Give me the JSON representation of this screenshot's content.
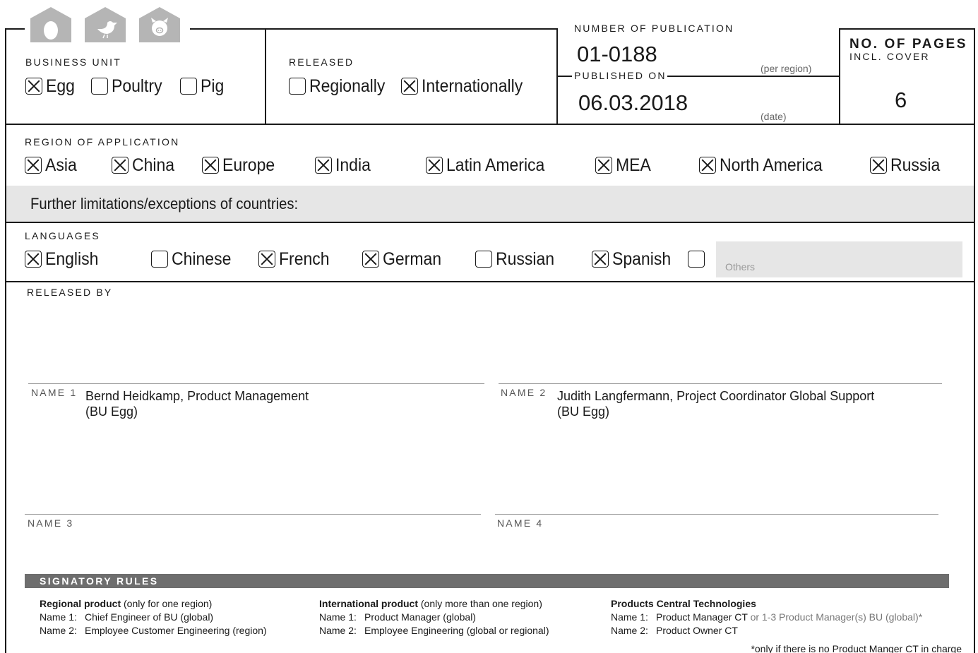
{
  "business_unit": {
    "label": "BUSINESS UNIT",
    "options": [
      {
        "label": "Egg",
        "checked": true
      },
      {
        "label": "Poultry",
        "checked": false
      },
      {
        "label": "Pig",
        "checked": false
      }
    ],
    "icons": [
      "egg-icon",
      "bird-icon",
      "pig-icon"
    ]
  },
  "released": {
    "label": "RELEASED",
    "options": [
      {
        "label": "Regionally",
        "checked": false
      },
      {
        "label": "Internationally",
        "checked": true
      }
    ]
  },
  "publication": {
    "number_label": "NUMBER OF PUBLICATION",
    "number": "01-0188",
    "number_hint": "(per region)",
    "published_label": "PUBLISHED ON",
    "date": "06.03.2018",
    "date_hint": "(date)"
  },
  "pages": {
    "label": "NO. OF PAGES",
    "sublabel": "INCL. COVER",
    "value": "6"
  },
  "region": {
    "label": "REGION OF APPLICATION",
    "options": [
      {
        "label": "Asia",
        "checked": true
      },
      {
        "label": "China",
        "checked": true
      },
      {
        "label": "Europe",
        "checked": true
      },
      {
        "label": "India",
        "checked": true
      },
      {
        "label": "Latin America",
        "checked": true
      },
      {
        "label": "MEA",
        "checked": true
      },
      {
        "label": "North America",
        "checked": true
      },
      {
        "label": "Russia",
        "checked": true
      }
    ],
    "limitations_label": "Further limitations/exceptions of countries:"
  },
  "languages": {
    "label": "LANGUAGES",
    "options": [
      {
        "label": "English",
        "checked": true
      },
      {
        "label": "Chinese",
        "checked": false
      },
      {
        "label": "French",
        "checked": true
      },
      {
        "label": "German",
        "checked": true
      },
      {
        "label": "Russian",
        "checked": false
      },
      {
        "label": "Spanish",
        "checked": true
      },
      {
        "label": "",
        "checked": false
      }
    ],
    "others_placeholder": "Others"
  },
  "released_by": {
    "label": "RELEASED BY",
    "name1_label": "NAME 1",
    "name1_line1": "Bernd Heidkamp, Product Management",
    "name1_line2": "(BU Egg)",
    "name2_label": "NAME 2",
    "name2_line1": "Judith Langfermann, Project Coordinator Global Support",
    "name2_line2": "(BU Egg)",
    "name3_label": "NAME 3",
    "name4_label": "NAME 4"
  },
  "signatory": {
    "title": "SIGNATORY RULES",
    "regional": {
      "heading": "Regional product",
      "note": " (only for one region)",
      "name1_label": "Name 1:",
      "name1": "Chief Engineer of BU (global)",
      "name2_label": "Name 2:",
      "name2": "Employee Customer Engineering (region)"
    },
    "international": {
      "heading": "International product",
      "note": " (only more than one region)",
      "name1_label": "Name 1:",
      "name1": "Product Manager (global)",
      "name2_label": "Name 2:",
      "name2": "Employee Engineering (global or regional)"
    },
    "central": {
      "heading": "Products Central Technologies",
      "name1_label": "Name 1:",
      "name1": "Product Manager CT",
      "name1_extra": " or 1-3 Product Manager(s) BU (global)*",
      "name2_label": "Name 2:",
      "name2": "Product Owner CT"
    },
    "footnote": "*only if there is no Product Manger CT in charge"
  }
}
